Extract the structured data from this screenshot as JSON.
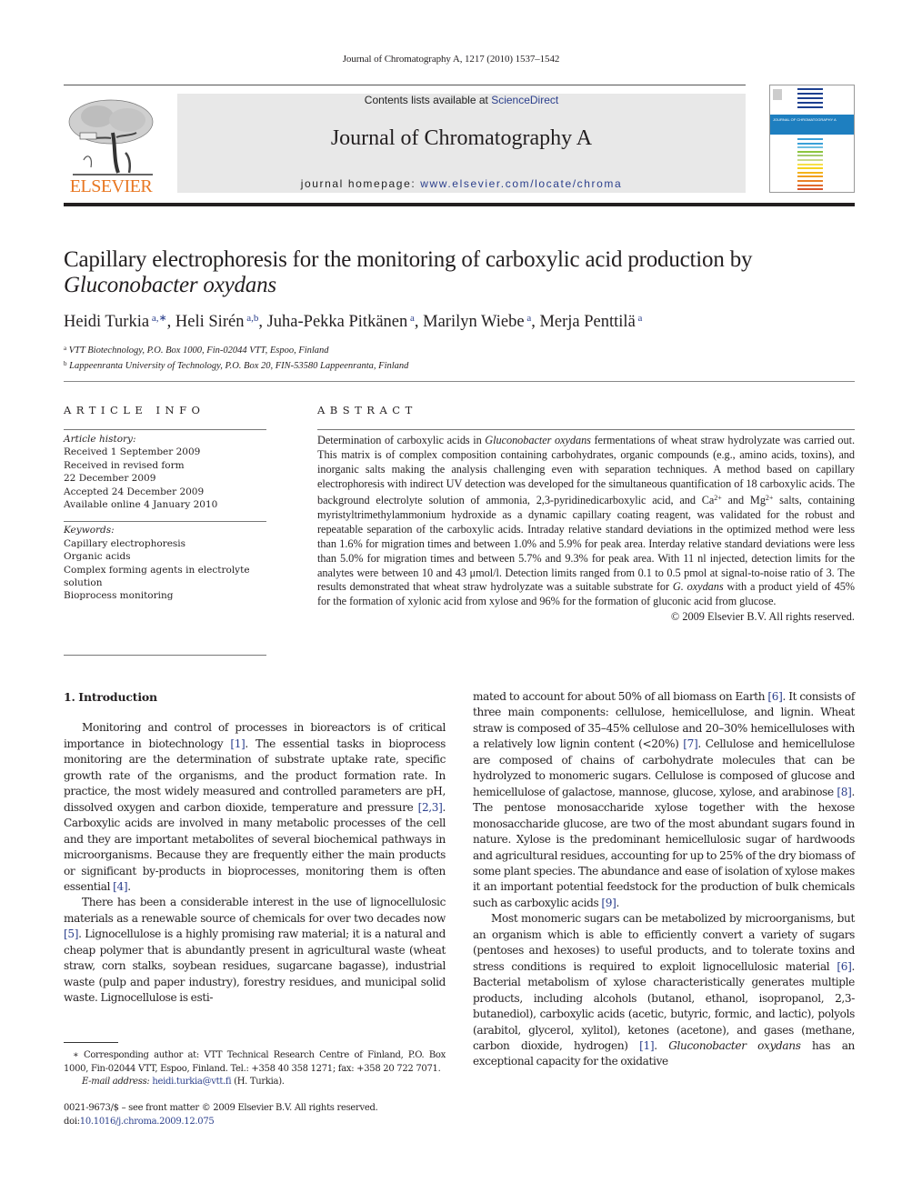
{
  "running_head": "Journal of Chromatography A, 1217 (2010) 1537–1542",
  "publisher": {
    "logo_icon": "elsevier-tree-icon",
    "name": "ELSEVIER"
  },
  "banner": {
    "contents_prefix": "Contents lists available at ",
    "contents_link": "ScienceDirect",
    "journal_title": "Journal of Chromatography A",
    "homepage_prefix": "journal homepage: ",
    "homepage_link": "www.elsevier.com/locate/chroma"
  },
  "cover": {
    "icon": "journal-cover-thumbnail",
    "band_text": "JOURNAL OF CHROMATOGRAPHY A",
    "stripe_colors": [
      "#1c3f8f",
      "#1c3f8f",
      "#1c3f8f",
      "#1c3f8f",
      "#1c3f8f",
      "#3aa0d8",
      "#3aa0d8",
      "#6fbfe0",
      "#8cc63f",
      "#a3c96e",
      "#c8d98a",
      "#f6e04a",
      "#f7d31e",
      "#f4b41a",
      "#f19f1e",
      "#e98127",
      "#e26a2c",
      "#d9542b"
    ]
  },
  "article": {
    "title_line1": "Capillary electrophoresis for the monitoring of carboxylic acid production by",
    "title_line2_italic": "Gluconobacter oxydans",
    "authors": [
      {
        "name": "Heidi Turkia",
        "sup": "a,∗"
      },
      {
        "name": "Heli Sirén",
        "sup": "a,b"
      },
      {
        "name": "Juha-Pekka Pitkänen",
        "sup": "a"
      },
      {
        "name": "Marilyn Wiebe",
        "sup": "a"
      },
      {
        "name": "Merja Penttilä",
        "sup": "a"
      }
    ],
    "affiliations": [
      {
        "mark": "a",
        "text": "VTT Biotechnology, P.O. Box 1000, Fin-02044 VTT, Espoo, Finland"
      },
      {
        "mark": "b",
        "text": "Lappeenranta University of Technology, P.O. Box 20, FIN-53580 Lappeenranta, Finland"
      }
    ]
  },
  "article_info": {
    "heading": "ARTICLE INFO",
    "history_label": "Article history:",
    "history": [
      "Received 1 September 2009",
      "Received in revised form",
      "22 December 2009",
      "Accepted 24 December 2009",
      "Available online 4 January 2010"
    ],
    "keywords_label": "Keywords:",
    "keywords": [
      "Capillary electrophoresis",
      "Organic acids",
      "Complex forming agents in electrolyte",
      "solution",
      "Bioprocess monitoring"
    ]
  },
  "abstract": {
    "heading": "ABSTRACT",
    "part1": "Determination of carboxylic acids in ",
    "italic1": "Gluconobacter oxydans",
    "part2": " fermentations of wheat straw hydrolyzate was carried out. This matrix is of complex composition containing carbohydrates, organic compounds (e.g., amino acids, toxins), and inorganic salts making the analysis challenging even with separation techniques. A method based on capillary electrophoresis with indirect UV detection was developed for the simultaneous quantification of 18 carboxylic acids. The background electrolyte solution of ammonia, 2,3-pyridinedicarboxylic acid, and Ca",
    "sup1": "2+",
    "part3": " and Mg",
    "sup2": "2+",
    "part4": " salts, containing myristyltrimethylammonium hydroxide as a dynamic capillary coating reagent, was validated for the robust and repeatable separation of the carboxylic acids. Intraday relative standard deviations in the optimized method were less than 1.6% for migration times and between 1.0% and 5.9% for peak area. Interday relative standard deviations were less than 5.0% for migration times and between 5.7% and 9.3% for peak area. With 11 nl injected, detection limits for the analytes were between 10 and 43 μmol/l. Detection limits ranged from 0.1 to 0.5 pmol at signal-to-noise ratio of 3. The results demonstrated that wheat straw hydrolyzate was a suitable substrate for ",
    "italic2": "G. oxydans",
    "part5": " with a product yield of 45% for the formation of xylonic acid from xylose and 96% for the formation of gluconic acid from glucose.",
    "copyright": "© 2009 Elsevier B.V. All rights reserved."
  },
  "body": {
    "section_heading": "1.  Introduction",
    "p1": [
      {
        "t": "Monitoring and control of processes in bioreactors is of critical importance in biotechnology "
      },
      {
        "ref": "[1]"
      },
      {
        "t": ". The essential tasks in bioprocess monitoring are the determination of substrate uptake rate, specific growth rate of the organisms, and the product formation rate. In practice, the most widely measured and controlled parameters are pH, dissolved oxygen and carbon dioxide, temperature and pressure "
      },
      {
        "ref": "[2,3]"
      },
      {
        "t": ". Carboxylic acids are involved in many metabolic processes of the cell and they are important metabolites of several biochemical pathways in microorganisms. Because they are frequently either the main products or significant by-products in bioprocesses, monitoring them is often essential "
      },
      {
        "ref": "[4]"
      },
      {
        "t": "."
      }
    ],
    "p2": [
      {
        "t": "There has been a considerable interest in the use of lignocellulosic materials as a renewable source of chemicals for over two decades now "
      },
      {
        "ref": "[5]"
      },
      {
        "t": ". Lignocellulose is a highly promising raw material; it is a natural and cheap polymer that is abundantly present in agricultural waste (wheat straw, corn stalks, soybean residues, sugarcane bagasse), industrial waste (pulp and paper industry), forestry residues, and municipal solid waste. Lignocellulose is estimated to account for about 50% of all biomass on Earth "
      },
      {
        "ref": "[6]"
      },
      {
        "t": ". It consists of three main components: cellulose, hemicellulose, and lignin. Wheat straw is composed of 35–45% cellulose and 20–30% hemicelluloses with a relatively low lignin content (<20%) "
      },
      {
        "ref": "[7]"
      },
      {
        "t": ". Cellulose and hemicellulose are composed of chains of carbohydrate molecules that can be hydrolyzed to monomeric sugars. Cellulose is composed of glucose and hemicellulose of galactose, mannose, glucose, xylose, and arabinose "
      },
      {
        "ref": "[8]"
      },
      {
        "t": ". The pentose monosaccharide xylose together with the hexose monosaccharide glucose, are two of the most abundant sugars found in nature. Xylose is the predominant hemicellulosic sugar of hardwoods and agricultural residues, accounting for up to 25% of the dry biomass of some plant species. The abundance and ease of isolation of xylose makes it an important potential feedstock for the production of bulk chemicals such as carboxylic acids "
      },
      {
        "ref": "[9]"
      },
      {
        "t": "."
      }
    ],
    "p3": [
      {
        "t": "Most monomeric sugars can be metabolized by microorganisms, but an organism which is able to efficiently convert a variety of sugars (pentoses and hexoses) to useful products, and to tolerate toxins and stress conditions is required to exploit lignocellulosic material "
      },
      {
        "ref": "[6]"
      },
      {
        "t": ". Bacterial metabolism of xylose characteristically generates multiple products, including alcohols (butanol, ethanol, isopropanol, 2,3-butanediol), carboxylic acids (acetic, butyric, formic, and lactic), polyols (arabitol, glycerol, xylitol), ketones (acetone), and gases (methane, carbon dioxide, hydrogen) "
      },
      {
        "ref": "[1]"
      },
      {
        "t": ". "
      },
      {
        "i": "Gluconobacter oxydans"
      },
      {
        "t": " has an exceptional capacity for the oxidative"
      }
    ]
  },
  "footnote": {
    "corresponding": "∗ Corresponding author at: VTT Technical Research Centre of Finland, P.O. Box 1000, Fin-02044 VTT, Espoo, Finland. Tel.: +358 40 358 1271; fax: +358 20 722 7071.",
    "email_label": "E-mail address:",
    "email": "heidi.turkia@vtt.fi",
    "email_suffix": " (H. Turkia)."
  },
  "issn": {
    "line1": "0021-9673/$ – see front matter © 2009 Elsevier B.V. All rights reserved.",
    "doi_prefix": "doi:",
    "doi": "10.1016/j.chroma.2009.12.075"
  }
}
